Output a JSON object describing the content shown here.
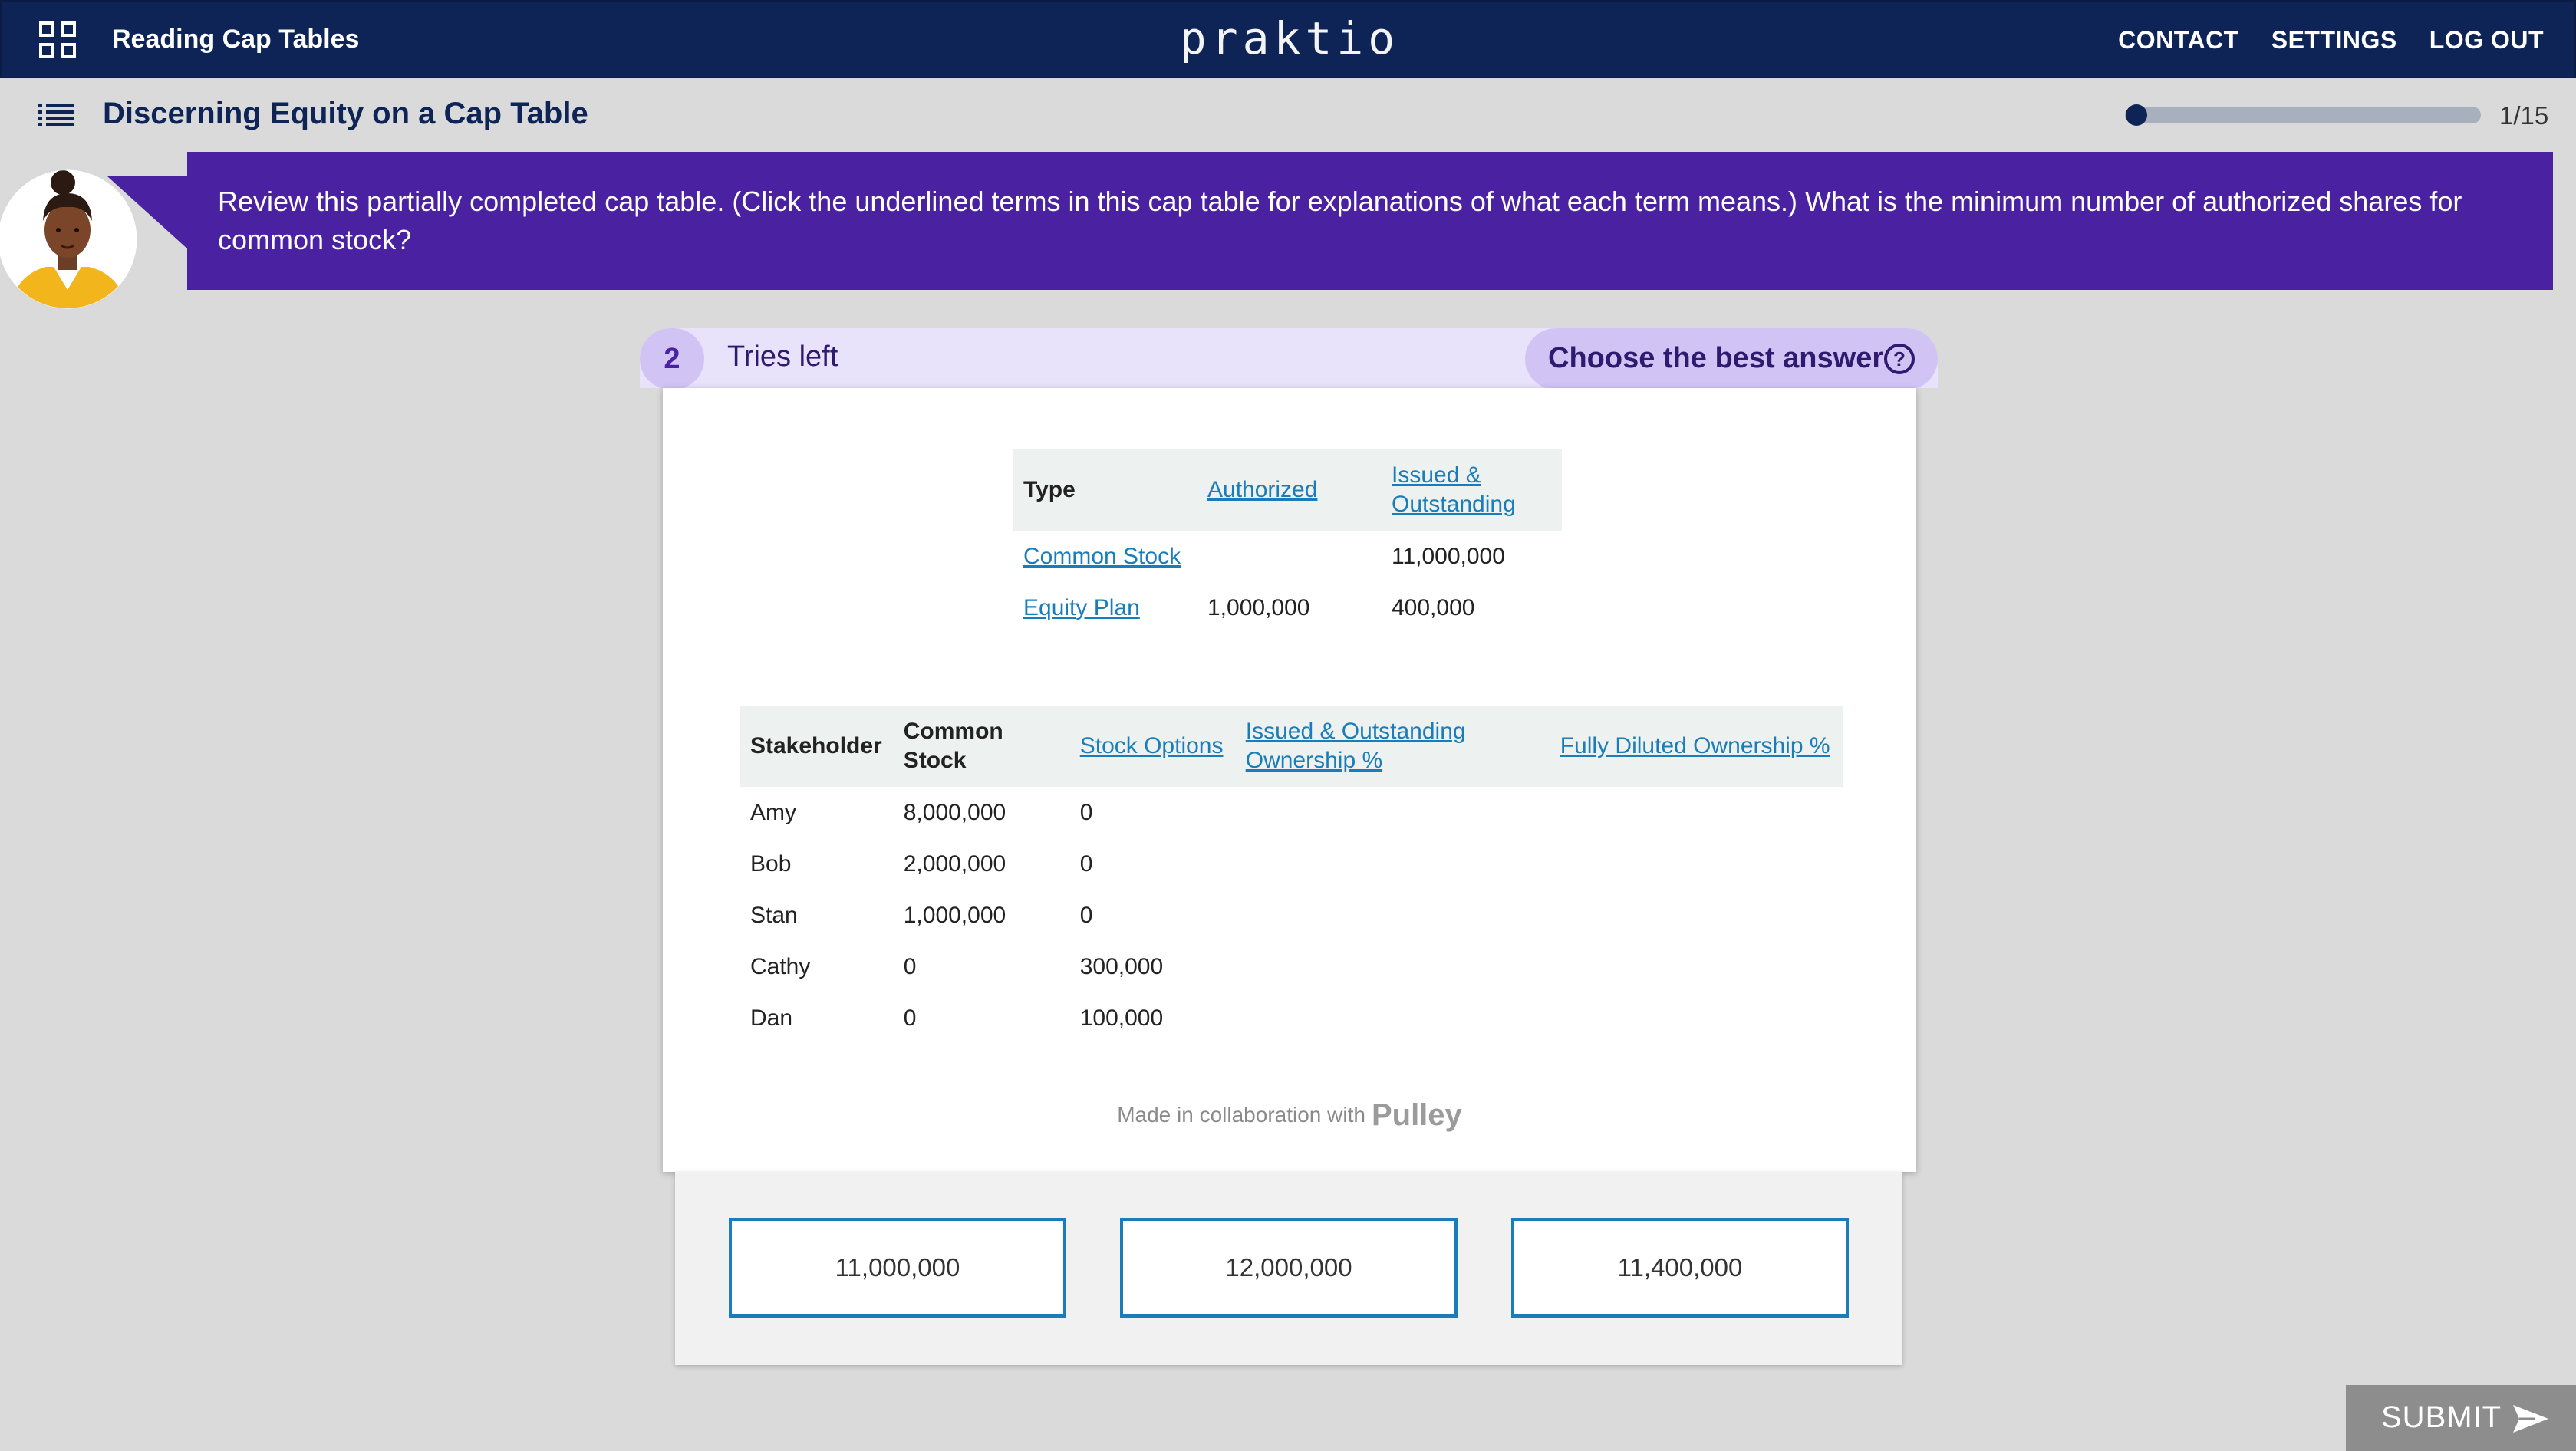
{
  "app": {
    "brand": "praktio",
    "course_title": "Reading Cap Tables",
    "nav": [
      "CONTACT",
      "SETTINGS",
      "LOG OUT"
    ]
  },
  "lesson": {
    "title": "Discerning Equity on a Cap Table",
    "progress_text": "1/15",
    "progress_fraction": 0.0667
  },
  "prompt": {
    "text": "Review this partially completed cap table. (Click the underlined terms in this cap table for explanations of what each term means.) What is the minimum number of authorized shares for common stock?"
  },
  "question": {
    "tries_left": "2",
    "tries_label": "Tries left",
    "mode_label": "Choose the best answer"
  },
  "cap_table": {
    "headers": [
      "Type",
      "Authorized",
      "Issued & Outstanding"
    ],
    "rows": [
      {
        "type": "Common Stock",
        "authorized": "",
        "issued": "11,000,000"
      },
      {
        "type": "Equity Plan",
        "authorized": "1,000,000",
        "issued": "400,000"
      }
    ]
  },
  "stakeholders": {
    "headers": [
      "Stakeholder",
      "Common Stock",
      "Stock Options",
      "Issued & Outstanding Ownership %",
      "Fully Diluted Ownership %"
    ],
    "rows": [
      {
        "name": "Amy",
        "common": "8,000,000",
        "options": "0",
        "issued_pct": "",
        "diluted_pct": ""
      },
      {
        "name": "Bob",
        "common": "2,000,000",
        "options": "0",
        "issued_pct": "",
        "diluted_pct": ""
      },
      {
        "name": "Stan",
        "common": "1,000,000",
        "options": "0",
        "issued_pct": "",
        "diluted_pct": ""
      },
      {
        "name": "Cathy",
        "common": "0",
        "options": "300,000",
        "issued_pct": "",
        "diluted_pct": ""
      },
      {
        "name": "Dan",
        "common": "0",
        "options": "100,000",
        "issued_pct": "",
        "diluted_pct": ""
      }
    ]
  },
  "collab": {
    "text": "Made in collaboration with",
    "partner": "Pulley"
  },
  "choices": [
    "11,000,000",
    "12,000,000",
    "11,400,000"
  ],
  "submit_label": "SUBMIT",
  "colors": {
    "topbar": "#0e2456",
    "prompt_bg": "#4a22a1",
    "link": "#1a7dba",
    "tries_bg": "#e9e2fb",
    "submit_bg": "#8d8d8d"
  }
}
